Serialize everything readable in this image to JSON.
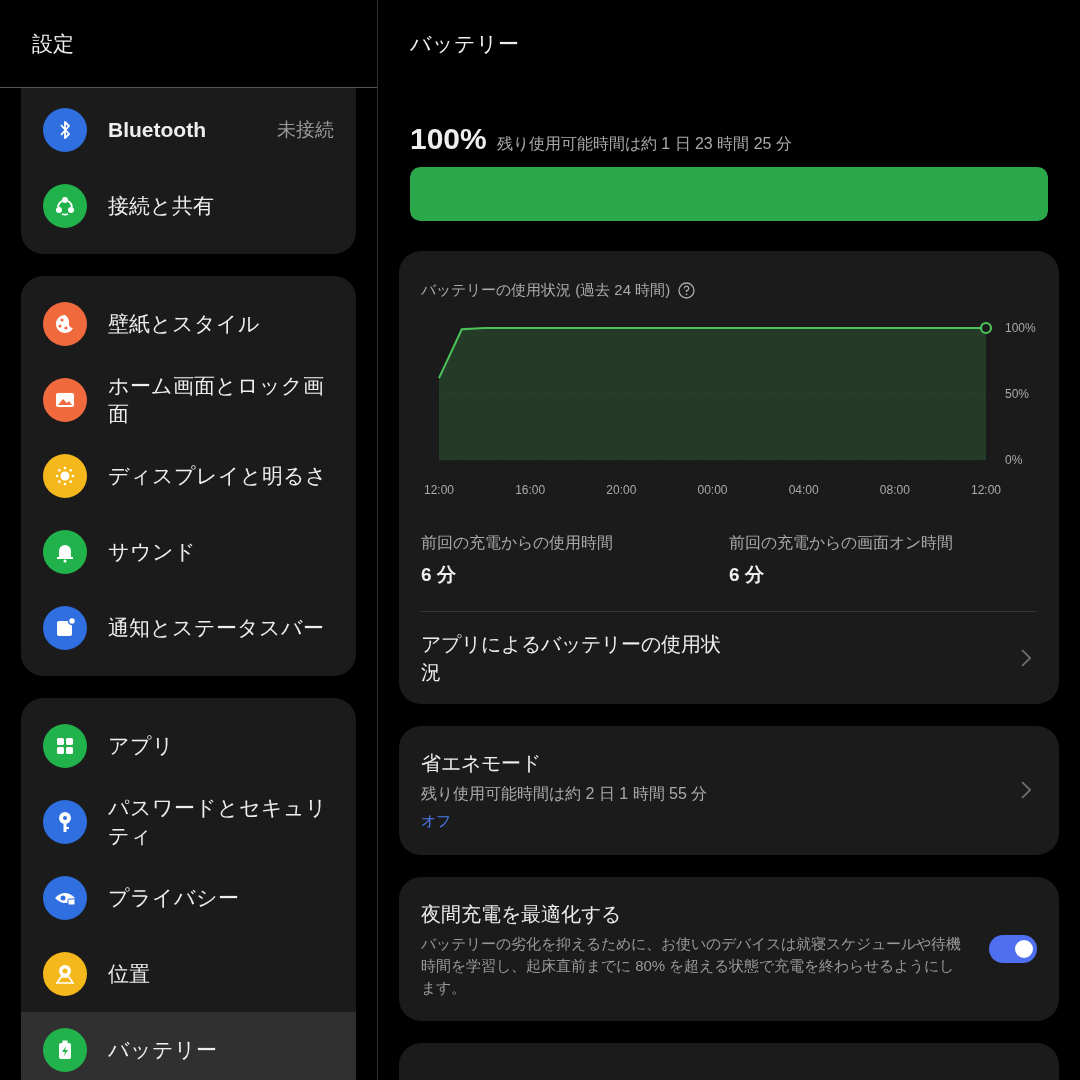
{
  "sidebar": {
    "title": "設定",
    "groups": [
      {
        "items": [
          {
            "label": "Bluetooth",
            "value": "未接続",
            "color": "#2f6fe0",
            "selected": false
          },
          {
            "label": "接続と共有",
            "color": "#22b24c",
            "selected": false
          }
        ]
      },
      {
        "items": [
          {
            "label": "壁紙とスタイル",
            "color": "#f06a3e",
            "selected": false
          },
          {
            "label": "ホーム画面とロック画面",
            "color": "#f06a3e",
            "selected": false
          },
          {
            "label": "ディスプレイと明るさ",
            "color": "#f5b81c",
            "selected": false
          },
          {
            "label": "サウンド",
            "color": "#22b24c",
            "selected": false
          },
          {
            "label": "通知とステータスバー",
            "color": "#2f6fe0",
            "selected": false
          }
        ]
      },
      {
        "items": [
          {
            "label": "アプリ",
            "color": "#22b24c",
            "selected": false
          },
          {
            "label": "パスワードとセキュリティ",
            "color": "#2f6fe0",
            "selected": false
          },
          {
            "label": "プライバシー",
            "color": "#2f6fe0",
            "selected": false
          },
          {
            "label": "位置",
            "color": "#f5b81c",
            "selected": false
          },
          {
            "label": "バッテリー",
            "color": "#22b24c",
            "selected": true
          }
        ]
      }
    ]
  },
  "battery": {
    "title": "バッテリー",
    "percent": "100%",
    "remaining": "残り使用可能時間は約 1 日 23 時間 25 分",
    "level": 1.0,
    "usage": {
      "title": "バッテリーの使用状況 (過去 24 時間)",
      "chart_data": {
        "type": "area",
        "categories": [
          "12:00",
          null,
          null,
          null,
          "16:00",
          null,
          null,
          null,
          "20:00",
          null,
          null,
          null,
          "00:00",
          null,
          null,
          null,
          "04:00",
          null,
          null,
          null,
          "08:00",
          null,
          null,
          null,
          "12:00"
        ],
        "series": [
          {
            "color": "#4cc35a",
            "values": [
              62,
              99,
              100,
              100,
              100,
              100,
              100,
              100,
              100,
              100,
              100,
              100,
              100,
              100,
              100,
              100,
              100,
              100,
              100,
              100,
              100,
              100,
              100,
              100,
              100
            ]
          }
        ],
        "ylim": [
          0,
          100
        ],
        "yticks": [
          {
            "value": 0,
            "label": "0%"
          },
          {
            "value": 50,
            "label": "50%"
          },
          {
            "value": 100,
            "label": "100%"
          }
        ]
      },
      "stats": [
        {
          "label": "前回の充電からの使用時間",
          "value": "6 分"
        },
        {
          "label": "前回の充電からの画面オン時間",
          "value": "6 分"
        }
      ],
      "app_usage": "アプリによるバッテリーの使用状況"
    },
    "power_saving": {
      "title": "省エネモード",
      "subtitle": "残り使用可能時間は約 2 日 1 時間 55 分",
      "status": "オフ"
    },
    "night_charge": {
      "title": "夜間充電を最適化する",
      "description": "バッテリーの劣化を抑えるために、お使いのデバイスは就寝スケジュールや待機時間を学習し、起床直前までに 80% を超える状態で充電を終わらせるようにします。",
      "on": true
    }
  }
}
